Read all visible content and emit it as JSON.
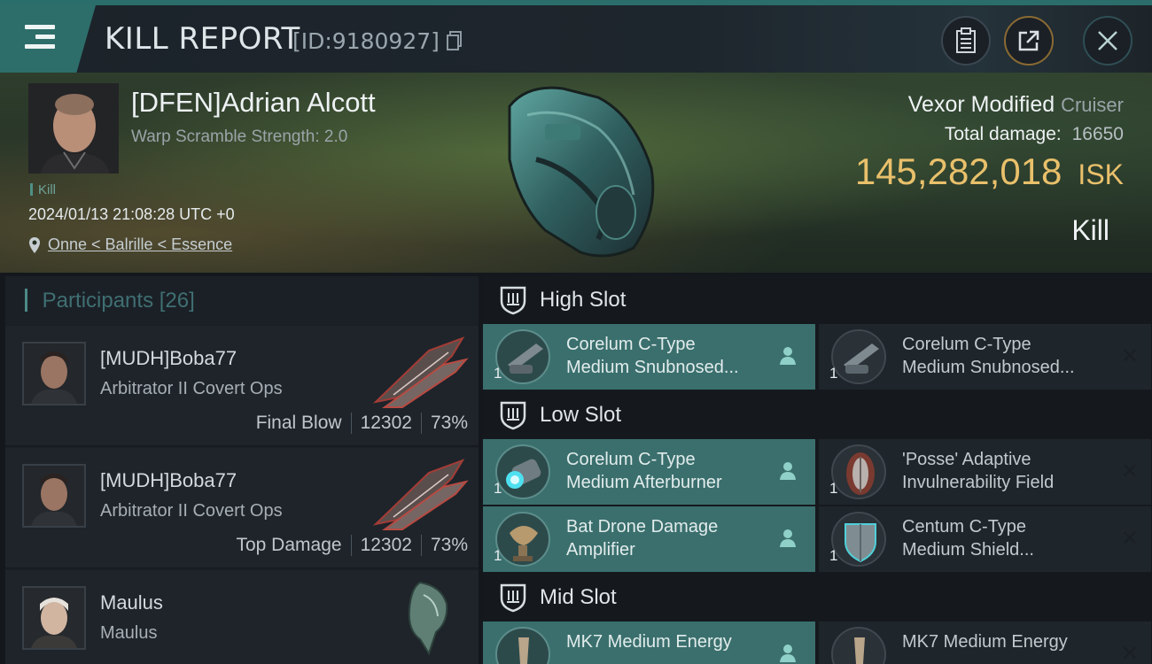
{
  "header": {
    "title": "KILL REPORT",
    "report_id": "[ID:9180927]"
  },
  "victim": {
    "name": "[DFEN]Adrian Alcott",
    "warp_scramble": "Warp Scramble Strength: 2.0",
    "tag": "Kill",
    "datetime": "2024/01/13 21:08:28 UTC +0",
    "location": "Onne < Balrille < Essence",
    "ship_name": "Vexor Modified",
    "ship_class": "Cruiser",
    "total_damage_label": "Total damage:",
    "total_damage": "16650",
    "isk_value": "145,282,018",
    "isk_unit": "ISK",
    "result": "Kill"
  },
  "participants": {
    "label": "Participants",
    "count": "[26]",
    "rows": [
      {
        "name": "[MUDH]Boba77",
        "ship": "Arbitrator II Covert Ops",
        "role": "Final Blow",
        "damage": "12302",
        "percent": "73%"
      },
      {
        "name": "[MUDH]Boba77",
        "ship": "Arbitrator II Covert Ops",
        "role": "Top Damage",
        "damage": "12302",
        "percent": "73%"
      },
      {
        "name": "Maulus",
        "ship": "Maulus"
      }
    ]
  },
  "slots": {
    "high": {
      "label": "High Slot",
      "items": [
        {
          "qty": "1",
          "line1": "Corelum C-Type",
          "line2": "Medium Snubnosed...",
          "state": "active"
        },
        {
          "qty": "1",
          "line1": "Corelum C-Type",
          "line2": "Medium Snubnosed...",
          "state": "destroyed"
        }
      ]
    },
    "low": {
      "label": "Low Slot",
      "items": [
        {
          "qty": "1",
          "line1": "Corelum C-Type",
          "line2": "Medium Afterburner",
          "state": "active"
        },
        {
          "qty": "1",
          "line1": "'Posse' Adaptive",
          "line2": "Invulnerability Field",
          "state": "destroyed"
        },
        {
          "qty": "1",
          "line1": "Bat Drone Damage",
          "line2": "Amplifier",
          "state": "active"
        },
        {
          "qty": "1",
          "line1": "Centum C-Type",
          "line2": "Medium Shield...",
          "state": "destroyed"
        }
      ]
    },
    "mid": {
      "label": "Mid Slot",
      "items": [
        {
          "qty": "1",
          "line1": "MK7 Medium Energy",
          "state": "active"
        },
        {
          "qty": "1",
          "line1": "MK7 Medium Energy",
          "state": "destroyed"
        }
      ]
    }
  },
  "colors": {
    "accent": "#2d6e6a",
    "isk": "#e9c06b",
    "active_slot": "#3a6f6d"
  },
  "icons": [
    "menu-icon",
    "copy-icon",
    "clipboard-icon",
    "share-icon",
    "close-icon",
    "location-pin-icon",
    "shield-icon",
    "pilot-icon",
    "x-icon"
  ]
}
